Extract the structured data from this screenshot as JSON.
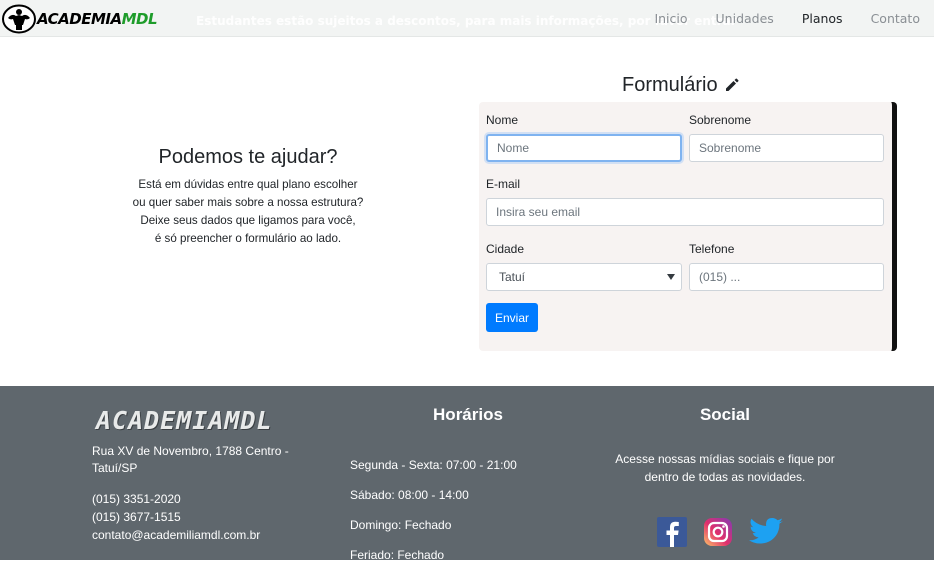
{
  "header": {
    "logo_main": "ACADEMIA",
    "logo_accent": "MDL",
    "marquee": "Estudantes estão sujeitos a descontos, para mais informações, por favor entrar em contato conosco.",
    "nav": [
      {
        "label": "Inicio",
        "active": false
      },
      {
        "label": "Unidades",
        "active": false
      },
      {
        "label": "Planos",
        "active": true
      },
      {
        "label": "Contato",
        "active": false
      }
    ]
  },
  "help": {
    "title": "Podemos te ajudar?",
    "lines": [
      "Está em dúvidas entre qual plano escolher",
      "ou quer saber mais sobre a nossa estrutura?",
      "Deixe seus dados que ligamos para você,",
      "é só preencher o formulário ao lado."
    ]
  },
  "form": {
    "title": "Formulário",
    "nome_label": "Nome",
    "nome_placeholder": "Nome",
    "sobrenome_label": "Sobrenome",
    "sobrenome_placeholder": "Sobrenome",
    "email_label": "E-mail",
    "email_placeholder": "Insira seu email",
    "cidade_label": "Cidade",
    "cidade_value": "Tatuí",
    "telefone_label": "Telefone",
    "telefone_placeholder": "(015) ...",
    "submit_label": "Enviar"
  },
  "footer": {
    "logo": "ACADEMIAMDL",
    "address": "Rua XV de Novembro, 1788 Centro - Tatuí/SP",
    "phone1": "(015) 3351-2020",
    "phone2": "(015) 3677-1515",
    "email": "contato@academiliamdl.com.br",
    "hours_title": "Horários",
    "hours": [
      "Segunda - Sexta: 07:00 - 21:00",
      "Sábado: 08:00 - 14:00",
      "Domingo: Fechado",
      "Feriado: Fechado"
    ],
    "social_title": "Social",
    "social_text": "Acesse nossas mídias sociais e fique por dentro de todas as novidades.",
    "social_icons": [
      "facebook-icon",
      "instagram-icon",
      "twitter-icon"
    ]
  },
  "colors": {
    "accent": "#007bff",
    "logo_green": "#1e9c2a",
    "footer_bg": "#5f676d",
    "card_bg": "#f7f3f2"
  }
}
